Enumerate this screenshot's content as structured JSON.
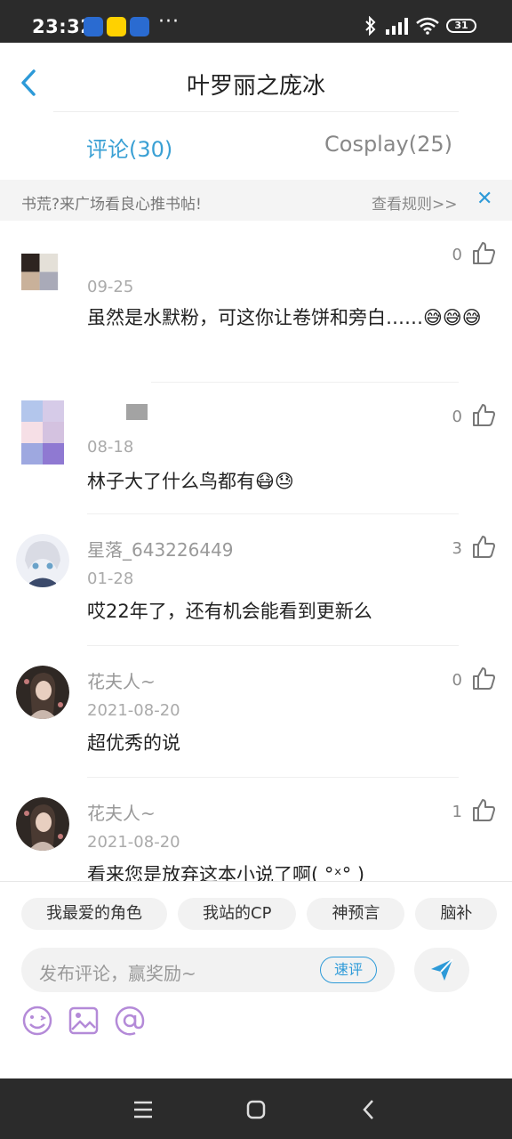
{
  "status_bar": {
    "time": "23:32",
    "dots": "···",
    "battery": "31"
  },
  "header": {
    "title": "叶罗丽之庞冰"
  },
  "tabs": [
    {
      "label": "评论(30)",
      "active": true
    },
    {
      "label": "Cosplay(25)",
      "active": false
    }
  ],
  "notice": {
    "text": "书荒?来广场看良心推书帖!",
    "rule_link": "查看规则>>",
    "close": "✕"
  },
  "comments": [
    {
      "username": "",
      "date": "09-25",
      "text": "虽然是水默粉，可这你让卷饼和旁白……😅😅😅",
      "likes": "0"
    },
    {
      "username": "",
      "date": "08-18",
      "text": "林子大了什么鸟都有😷😓",
      "likes": "0"
    },
    {
      "username": "星落_643226449",
      "date": "01-28",
      "text": "哎22年了，还有机会能看到更新么",
      "likes": "3"
    },
    {
      "username": "花夫人~",
      "date": "2021-08-20",
      "text": "超优秀的说",
      "likes": "0"
    },
    {
      "username": "花夫人~",
      "date": "2021-08-20",
      "text": "看来您是放弃这本小说了啊( °ˣ° )",
      "likes": "1"
    }
  ],
  "composer": {
    "chips": [
      "我最爱的角色",
      "我站的CP",
      "神预言",
      "脑补"
    ],
    "placeholder": "发布评论，赢奖励~",
    "quick_label": "速评"
  },
  "colors": {
    "accent": "#2d9ad8",
    "tab_active": "#3aa0d4",
    "status_bar": "#2b2b2b"
  }
}
